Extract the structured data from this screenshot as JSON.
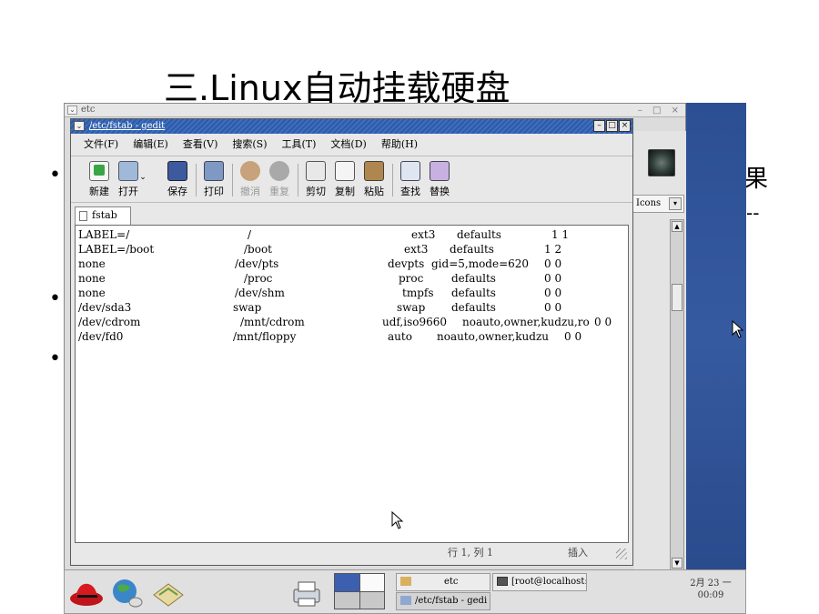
{
  "slide": {
    "title": "三.Linux自动挂载硬盘",
    "bullets": [
      "•",
      "•",
      "•"
    ],
    "partial_right_text": "果",
    "partial_dashes": "--"
  },
  "desktop": {
    "window_title": "etc",
    "window_controls": "– □ ×",
    "icon_view_label": "Icons"
  },
  "gedit": {
    "title": "/etc/fstab - gedit",
    "menu": [
      "文件(F)",
      "编辑(E)",
      "查看(V)",
      "搜索(S)",
      "工具(T)",
      "文档(D)",
      "帮助(H)"
    ],
    "toolbar": {
      "new": "新建",
      "open": "打开",
      "save": "保存",
      "print": "打印",
      "undo": "撤消",
      "redo": "重复",
      "cut": "剪切",
      "copy": "复制",
      "paste": "粘贴",
      "find": "查找",
      "replace": "替换"
    },
    "tab_label": "fstab",
    "lines": [
      [
        "LABEL=/",
        "/",
        "ext3",
        "defaults",
        "1 1"
      ],
      [
        "LABEL=/boot",
        "/boot",
        "ext3",
        "defaults",
        "1 2"
      ],
      [
        "none",
        "/dev/pts",
        "devpts",
        "gid=5,mode=620",
        "0 0"
      ],
      [
        "none",
        "/proc",
        "proc",
        "defaults",
        "0 0"
      ],
      [
        "none",
        "/dev/shm",
        "tmpfs",
        "defaults",
        "0 0"
      ],
      [
        "/dev/sda3",
        "swap",
        "swap",
        "defaults",
        "0 0"
      ],
      [
        "/dev/cdrom",
        "/mnt/cdrom",
        "udf,iso9660",
        "noauto,owner,kudzu,ro",
        "0 0"
      ],
      [
        "/dev/fd0",
        "/mnt/floppy",
        "auto",
        "noauto,owner,kudzu",
        "0 0"
      ]
    ],
    "status_position": "行 1, 列 1",
    "status_mode": "插入"
  },
  "taskbar": {
    "task_etc": "etc",
    "task_terminal": "[root@localhost:~]",
    "task_gedit": "/etc/fstab - gedi",
    "clock_date": "2月 23 一",
    "clock_time": "00:09"
  },
  "colors": {
    "gedit_titlebar": "#3c6fc0",
    "desktop_blue": "#2c4f93",
    "pager_active": "#3c5fb0"
  }
}
